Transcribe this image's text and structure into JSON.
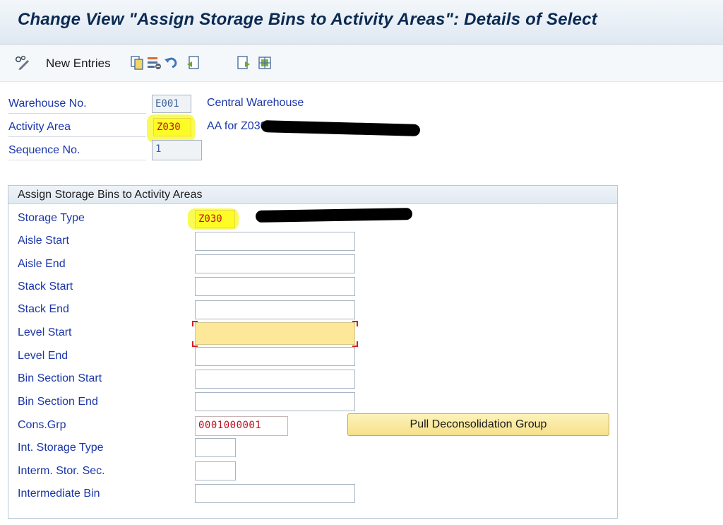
{
  "title": "Change View \"Assign Storage Bins to Activity Areas\": Details of Select",
  "toolbar": {
    "new_entries_label": "New Entries",
    "icons": [
      "glasses-pencil-icon",
      "copy-icon",
      "delete-icon",
      "undo-icon",
      "previous-entry-icon",
      "next-entry-icon",
      "select-all-icon"
    ]
  },
  "header": {
    "warehouse": {
      "label": "Warehouse No.",
      "value": "E001",
      "desc": "Central Warehouse"
    },
    "activity_area": {
      "label": "Activity Area",
      "value": "Z030",
      "desc": "AA for Z030"
    },
    "sequence": {
      "label": "Sequence No.",
      "value": "1"
    }
  },
  "group": {
    "title": "Assign Storage Bins to Activity Areas",
    "storage_type": {
      "label": "Storage Type",
      "value": "Z030"
    },
    "aisle_start": {
      "label": "Aisle Start",
      "value": ""
    },
    "aisle_end": {
      "label": "Aisle End",
      "value": ""
    },
    "stack_start": {
      "label": "Stack Start",
      "value": ""
    },
    "stack_end": {
      "label": "Stack End",
      "value": ""
    },
    "level_start": {
      "label": "Level Start",
      "value": ""
    },
    "level_end": {
      "label": "Level End",
      "value": ""
    },
    "bin_section_start": {
      "label": "Bin Section Start",
      "value": ""
    },
    "bin_section_end": {
      "label": "Bin Section End",
      "value": ""
    },
    "cons_grp": {
      "label": "Cons.Grp",
      "value": "0001000001"
    },
    "int_storage_type": {
      "label": "Int. Storage Type",
      "value": ""
    },
    "interm_stor_sec": {
      "label": "Interm. Stor. Sec.",
      "value": ""
    },
    "intermediate_bin": {
      "label": "Intermediate Bin",
      "value": ""
    },
    "pull_button_label": "Pull Deconsolidation Group"
  },
  "colors": {
    "label_blue": "#1b36a8",
    "title_navy": "#0b2a52",
    "highlight_yellow": "#fdfd25",
    "button_yellow": "#f6e08a",
    "focus_field": "#fde89a",
    "red_value": "#c1121f"
  }
}
